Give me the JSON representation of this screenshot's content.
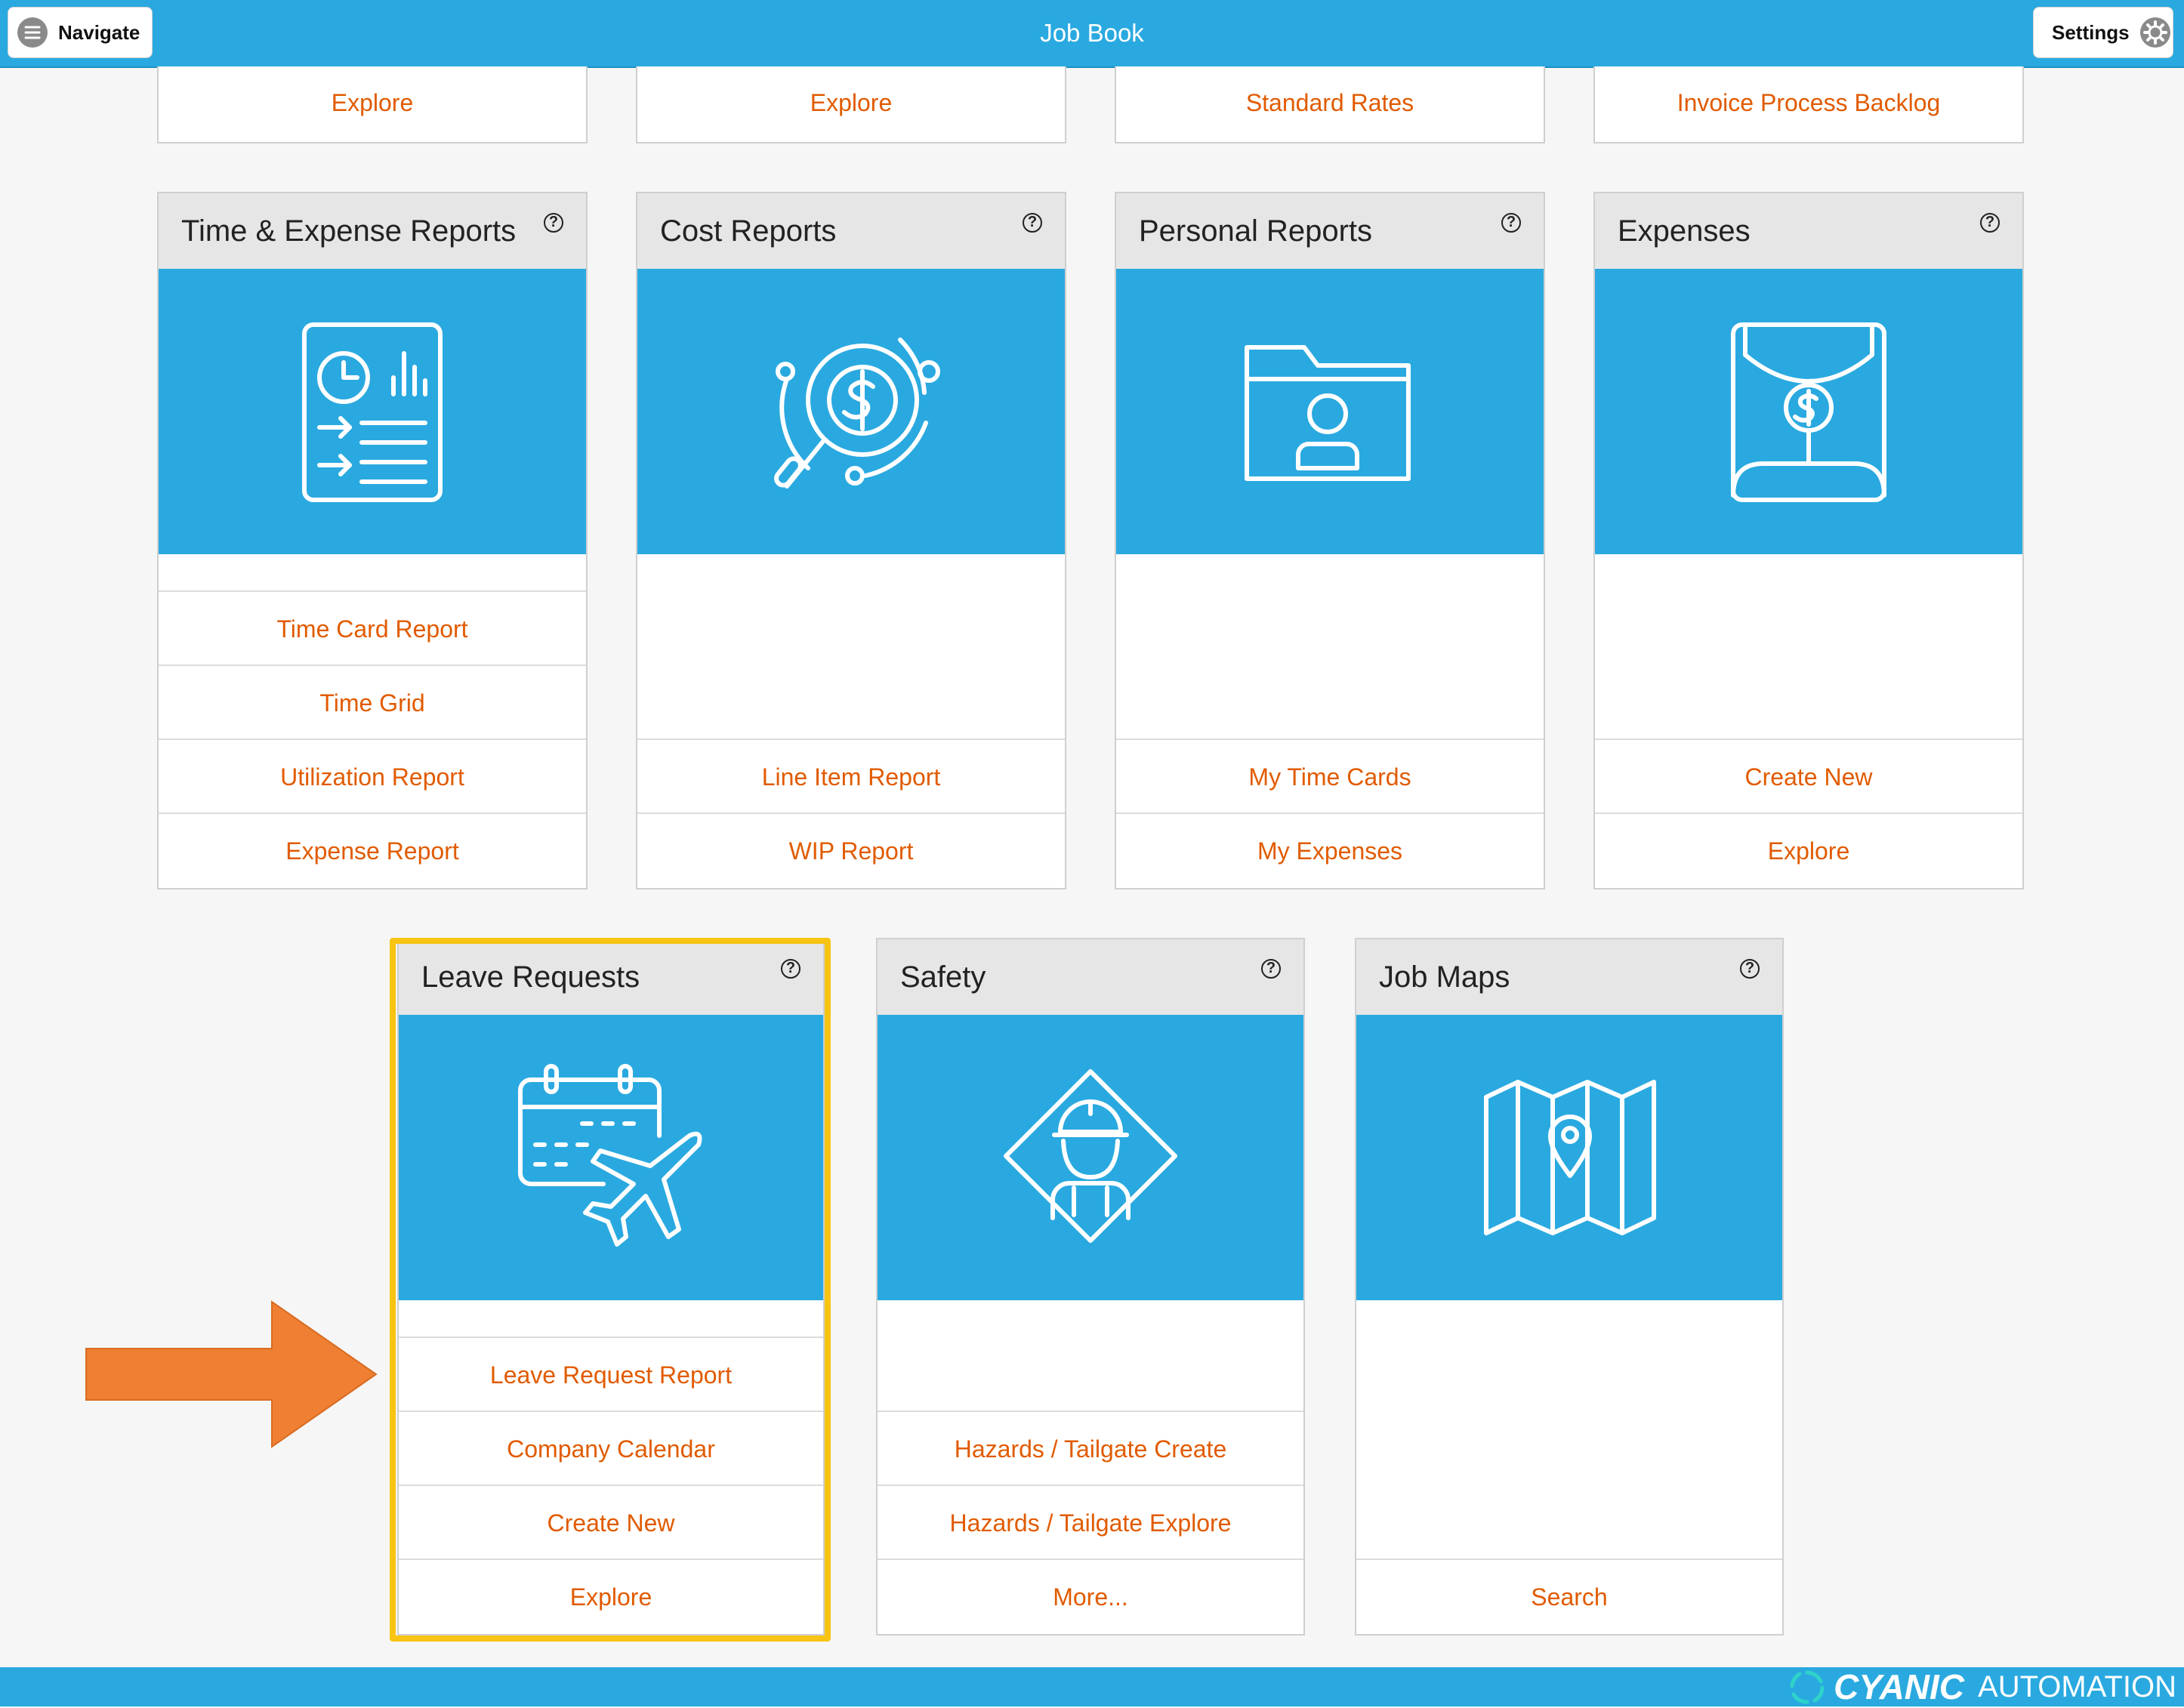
{
  "header": {
    "title": "Job Book",
    "navigate_label": "Navigate",
    "settings_label": "Settings"
  },
  "top_links": [
    "Explore",
    "Explore",
    "Standard Rates",
    "Invoice Process Backlog"
  ],
  "cards": [
    {
      "title": "Time & Expense Reports",
      "icon": "report-document-icon",
      "links": [
        "Time Card Report",
        "Time Grid",
        "Utilization Report",
        "Expense Report"
      ]
    },
    {
      "title": "Cost Reports",
      "icon": "cost-analysis-icon",
      "links": [
        "Line Item Report",
        "WIP Report"
      ]
    },
    {
      "title": "Personal Reports",
      "icon": "user-folder-icon",
      "links": [
        "My Time Cards",
        "My Expenses"
      ]
    },
    {
      "title": "Expenses",
      "icon": "money-envelope-icon",
      "links": [
        "Create New",
        "Explore"
      ]
    },
    {
      "title": "Leave Requests",
      "icon": "calendar-airplane-icon",
      "links": [
        "Leave Request Report",
        "Company Calendar",
        "Create New",
        "Explore"
      ]
    },
    {
      "title": "Safety",
      "icon": "worker-sign-icon",
      "links": [
        "Hazards / Tailgate Create",
        "Hazards / Tailgate Explore",
        "More..."
      ]
    },
    {
      "title": "Job Maps",
      "icon": "map-pin-icon",
      "links": [
        "Search"
      ]
    }
  ],
  "help_glyph": "?",
  "footer": {
    "brand_bold": "CYANIC",
    "brand_light": "AUTOMATION"
  },
  "colors": {
    "accent": "#2aa9e0",
    "link": "#e15b00",
    "highlight": "#f8c414",
    "arrow": "#ee7f33"
  }
}
